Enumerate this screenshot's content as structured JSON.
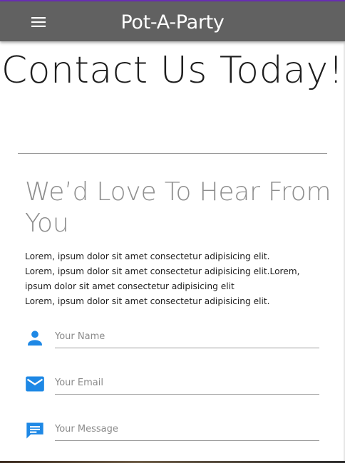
{
  "app_bar": {
    "title": "Pot-A-Party",
    "menu_icon": "menu-icon",
    "background": "#616161",
    "accent": "#6a2fb5"
  },
  "page": {
    "title": "Contact Us Today!"
  },
  "section": {
    "heading": "We’d Love To Hear From You",
    "paragraphs": [
      "Lorem, ipsum dolor sit amet consectetur adipisicing elit.",
      "Lorem, ipsum dolor sit amet consectetur adipisicing elit.Lorem, ipsum dolor sit amet consectetur adipisicing elit",
      "Lorem, ipsum dolor sit amet consectetur adipisicing elit."
    ]
  },
  "form": {
    "icon_color": "#1e88e5",
    "name": {
      "placeholder": "Your Name",
      "value": "",
      "icon": "person-icon"
    },
    "email": {
      "placeholder": "Your Email",
      "value": "",
      "icon": "email-icon"
    },
    "message": {
      "placeholder": "Your Message",
      "value": "",
      "icon": "message-icon"
    }
  }
}
